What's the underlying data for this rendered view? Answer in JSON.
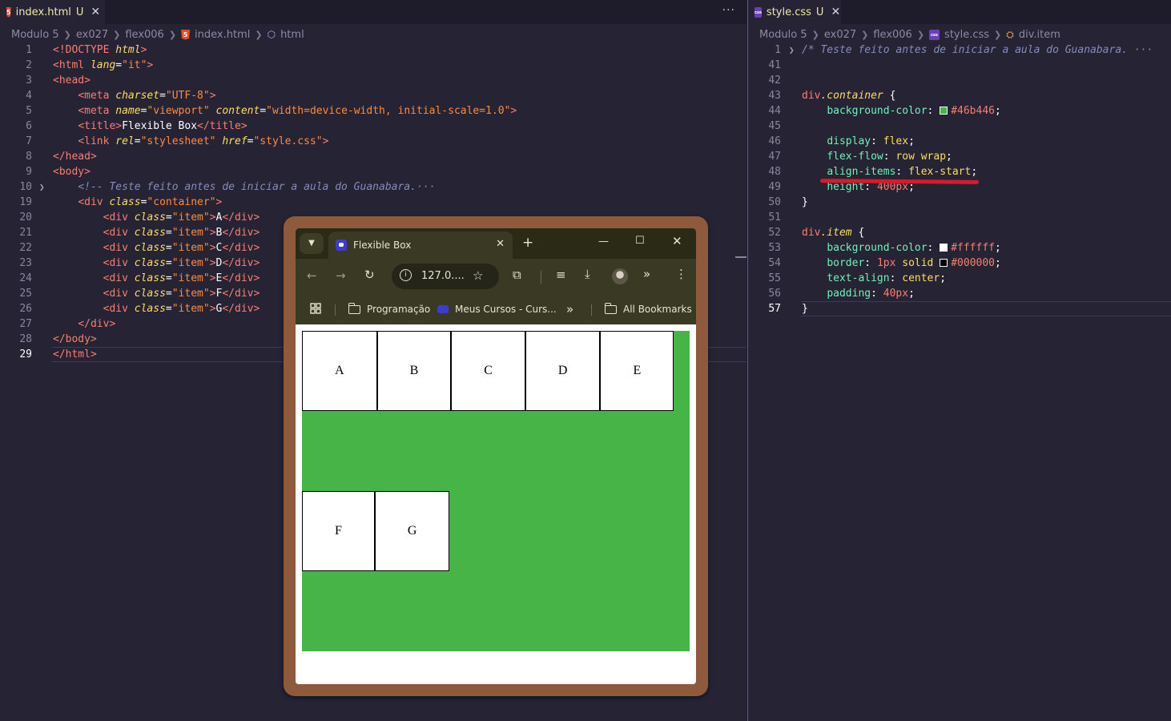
{
  "left_editor": {
    "tab": {
      "filename": "index.html",
      "status": "U",
      "icon": "html5-icon"
    },
    "more_actions": "···",
    "breadcrumb": [
      "Modulo 5",
      "ex027",
      "flex006",
      "index.html",
      "html"
    ],
    "lines": [
      {
        "n": "1",
        "parts": [
          [
            "t-tag",
            "<!"
          ],
          [
            "t-tag",
            "DOCTYPE"
          ],
          [
            "t-txt",
            " "
          ],
          [
            "t-attr",
            "html"
          ],
          [
            "t-tag",
            ">"
          ]
        ]
      },
      {
        "n": "2",
        "parts": [
          [
            "t-tag",
            "<html"
          ],
          [
            "t-txt",
            " "
          ],
          [
            "t-attr",
            "lang"
          ],
          [
            "t-pun",
            "="
          ],
          [
            "t-str",
            "\"it\""
          ],
          [
            "t-tag",
            ">"
          ]
        ]
      },
      {
        "n": "3",
        "parts": [
          [
            "t-tag",
            "<head>"
          ]
        ]
      },
      {
        "n": "4",
        "parts": [
          [
            "t-txt",
            "    "
          ],
          [
            "t-tag",
            "<meta"
          ],
          [
            "t-txt",
            " "
          ],
          [
            "t-attr",
            "charset"
          ],
          [
            "t-pun",
            "="
          ],
          [
            "t-str",
            "\"UTF-8\""
          ],
          [
            "t-tag",
            ">"
          ]
        ]
      },
      {
        "n": "5",
        "parts": [
          [
            "t-txt",
            "    "
          ],
          [
            "t-tag",
            "<meta"
          ],
          [
            "t-txt",
            " "
          ],
          [
            "t-attr",
            "name"
          ],
          [
            "t-pun",
            "="
          ],
          [
            "t-str",
            "\"viewport\""
          ],
          [
            "t-txt",
            " "
          ],
          [
            "t-attr",
            "content"
          ],
          [
            "t-pun",
            "="
          ],
          [
            "t-str",
            "\"width=device-width, initial-scale=1.0\""
          ],
          [
            "t-tag",
            ">"
          ]
        ]
      },
      {
        "n": "6",
        "parts": [
          [
            "t-txt",
            "    "
          ],
          [
            "t-tag",
            "<title>"
          ],
          [
            "t-txt",
            "Flexible Box"
          ],
          [
            "t-tag",
            "</title>"
          ]
        ]
      },
      {
        "n": "7",
        "parts": [
          [
            "t-txt",
            "    "
          ],
          [
            "t-tag",
            "<link"
          ],
          [
            "t-txt",
            " "
          ],
          [
            "t-attr",
            "rel"
          ],
          [
            "t-pun",
            "="
          ],
          [
            "t-str",
            "\"stylesheet\""
          ],
          [
            "t-txt",
            " "
          ],
          [
            "t-attr",
            "href"
          ],
          [
            "t-pun",
            "="
          ],
          [
            "t-str",
            "\"style.css\""
          ],
          [
            "t-tag",
            ">"
          ]
        ]
      },
      {
        "n": "8",
        "parts": [
          [
            "t-tag",
            "</head>"
          ]
        ]
      },
      {
        "n": "9",
        "parts": [
          [
            "t-tag",
            "<body>"
          ]
        ]
      },
      {
        "n": "10",
        "fold": true,
        "parts": [
          [
            "t-txt",
            "    "
          ],
          [
            "t-cmt",
            "<!-- Teste feito antes de iniciar a aula do Guanabara."
          ],
          [
            "t-ell",
            "···"
          ]
        ]
      },
      {
        "n": "19",
        "parts": [
          [
            "t-txt",
            "    "
          ],
          [
            "t-tag",
            "<div"
          ],
          [
            "t-txt",
            " "
          ],
          [
            "t-attr",
            "class"
          ],
          [
            "t-pun",
            "="
          ],
          [
            "t-str",
            "\"container\""
          ],
          [
            "t-tag",
            ">"
          ]
        ]
      },
      {
        "n": "20",
        "parts": [
          [
            "t-txt",
            "        "
          ],
          [
            "t-tag",
            "<div"
          ],
          [
            "t-txt",
            " "
          ],
          [
            "t-attr",
            "class"
          ],
          [
            "t-pun",
            "="
          ],
          [
            "t-str",
            "\"item\""
          ],
          [
            "t-tag",
            ">"
          ],
          [
            "t-txt",
            "A"
          ],
          [
            "t-tag",
            "</div>"
          ]
        ]
      },
      {
        "n": "21",
        "parts": [
          [
            "t-txt",
            "        "
          ],
          [
            "t-tag",
            "<div"
          ],
          [
            "t-txt",
            " "
          ],
          [
            "t-attr",
            "class"
          ],
          [
            "t-pun",
            "="
          ],
          [
            "t-str",
            "\"item\""
          ],
          [
            "t-tag",
            ">"
          ],
          [
            "t-txt",
            "B"
          ],
          [
            "t-tag",
            "</div>"
          ]
        ]
      },
      {
        "n": "22",
        "parts": [
          [
            "t-txt",
            "        "
          ],
          [
            "t-tag",
            "<div"
          ],
          [
            "t-txt",
            " "
          ],
          [
            "t-attr",
            "class"
          ],
          [
            "t-pun",
            "="
          ],
          [
            "t-str",
            "\"item\""
          ],
          [
            "t-tag",
            ">"
          ],
          [
            "t-txt",
            "C"
          ],
          [
            "t-tag",
            "</div>"
          ]
        ]
      },
      {
        "n": "23",
        "parts": [
          [
            "t-txt",
            "        "
          ],
          [
            "t-tag",
            "<div"
          ],
          [
            "t-txt",
            " "
          ],
          [
            "t-attr",
            "class"
          ],
          [
            "t-pun",
            "="
          ],
          [
            "t-str",
            "\"item\""
          ],
          [
            "t-tag",
            ">"
          ],
          [
            "t-txt",
            "D"
          ],
          [
            "t-tag",
            "</div>"
          ]
        ]
      },
      {
        "n": "24",
        "parts": [
          [
            "t-txt",
            "        "
          ],
          [
            "t-tag",
            "<div"
          ],
          [
            "t-txt",
            " "
          ],
          [
            "t-attr",
            "class"
          ],
          [
            "t-pun",
            "="
          ],
          [
            "t-str",
            "\"item\""
          ],
          [
            "t-tag",
            ">"
          ],
          [
            "t-txt",
            "E"
          ],
          [
            "t-tag",
            "</div>"
          ]
        ]
      },
      {
        "n": "25",
        "parts": [
          [
            "t-txt",
            "        "
          ],
          [
            "t-tag",
            "<div"
          ],
          [
            "t-txt",
            " "
          ],
          [
            "t-attr",
            "class"
          ],
          [
            "t-pun",
            "="
          ],
          [
            "t-str",
            "\"item\""
          ],
          [
            "t-tag",
            ">"
          ],
          [
            "t-txt",
            "F"
          ],
          [
            "t-tag",
            "</div>"
          ]
        ]
      },
      {
        "n": "26",
        "parts": [
          [
            "t-txt",
            "        "
          ],
          [
            "t-tag",
            "<div"
          ],
          [
            "t-txt",
            " "
          ],
          [
            "t-attr",
            "class"
          ],
          [
            "t-pun",
            "="
          ],
          [
            "t-str",
            "\"item\""
          ],
          [
            "t-tag",
            ">"
          ],
          [
            "t-txt",
            "G"
          ],
          [
            "t-tag",
            "</div>"
          ]
        ]
      },
      {
        "n": "27",
        "parts": [
          [
            "t-txt",
            "    "
          ],
          [
            "t-tag",
            "</div>"
          ]
        ]
      },
      {
        "n": "28",
        "parts": [
          [
            "t-tag",
            "</body>"
          ]
        ]
      },
      {
        "n": "29",
        "current": true,
        "parts": [
          [
            "t-tag",
            "</html>"
          ]
        ]
      }
    ]
  },
  "right_editor": {
    "tab": {
      "filename": "style.css",
      "status": "U",
      "icon": "css-icon"
    },
    "breadcrumb": [
      "Modulo 5",
      "ex027",
      "flex006",
      "style.css",
      "div.item"
    ],
    "lines": [
      {
        "n": "1",
        "fold": true,
        "parts": [
          [
            "t-cmt",
            "/* Teste feito antes de iniciar a aula do Guanabara."
          ],
          [
            "t-ell",
            " ···"
          ]
        ]
      },
      {
        "n": "41",
        "parts": []
      },
      {
        "n": "42",
        "parts": []
      },
      {
        "n": "43",
        "parts": [
          [
            "t-sel",
            "div"
          ],
          [
            "t-cls",
            ".container"
          ],
          [
            "t-pun",
            " {"
          ]
        ]
      },
      {
        "n": "44",
        "parts": [
          [
            "t-txt",
            "    "
          ],
          [
            "t-prop",
            "background-color"
          ],
          [
            "t-pun",
            ": "
          ],
          [
            "swatch",
            "#46b446"
          ],
          [
            "t-hex",
            "#46b446"
          ],
          [
            "t-pun",
            ";"
          ]
        ]
      },
      {
        "n": "45",
        "parts": []
      },
      {
        "n": "46",
        "parts": [
          [
            "t-txt",
            "    "
          ],
          [
            "t-prop",
            "display"
          ],
          [
            "t-pun",
            ": "
          ],
          [
            "t-val",
            "flex"
          ],
          [
            "t-pun",
            ";"
          ]
        ]
      },
      {
        "n": "47",
        "parts": [
          [
            "t-txt",
            "    "
          ],
          [
            "t-prop",
            "flex-flow"
          ],
          [
            "t-pun",
            ": "
          ],
          [
            "t-val",
            "row wrap"
          ],
          [
            "t-pun",
            ";"
          ]
        ]
      },
      {
        "n": "48",
        "parts": [
          [
            "t-txt",
            "    "
          ],
          [
            "t-prop",
            "align-items"
          ],
          [
            "t-pun",
            ": "
          ],
          [
            "t-val",
            "flex-start"
          ],
          [
            "t-pun",
            ";"
          ]
        ]
      },
      {
        "n": "49",
        "parts": [
          [
            "t-txt",
            "    "
          ],
          [
            "t-prop",
            "height"
          ],
          [
            "t-pun",
            ": "
          ],
          [
            "t-num",
            "400px"
          ],
          [
            "t-pun",
            ";"
          ]
        ]
      },
      {
        "n": "50",
        "parts": [
          [
            "t-pun",
            "}"
          ]
        ]
      },
      {
        "n": "51",
        "parts": []
      },
      {
        "n": "52",
        "parts": [
          [
            "t-sel",
            "div"
          ],
          [
            "t-cls",
            ".item"
          ],
          [
            "t-pun",
            " {"
          ]
        ]
      },
      {
        "n": "53",
        "parts": [
          [
            "t-txt",
            "    "
          ],
          [
            "t-prop",
            "background-color"
          ],
          [
            "t-pun",
            ": "
          ],
          [
            "swatch",
            "#ffffff"
          ],
          [
            "t-hex",
            "#ffffff"
          ],
          [
            "t-pun",
            ";"
          ]
        ]
      },
      {
        "n": "54",
        "parts": [
          [
            "t-txt",
            "    "
          ],
          [
            "t-prop",
            "border"
          ],
          [
            "t-pun",
            ": "
          ],
          [
            "t-num",
            "1px"
          ],
          [
            "t-val",
            " solid "
          ],
          [
            "swatch",
            "#000000"
          ],
          [
            "t-hex",
            "#000000"
          ],
          [
            "t-pun",
            ";"
          ]
        ]
      },
      {
        "n": "55",
        "parts": [
          [
            "t-txt",
            "    "
          ],
          [
            "t-prop",
            "text-align"
          ],
          [
            "t-pun",
            ": "
          ],
          [
            "t-val",
            "center"
          ],
          [
            "t-pun",
            ";"
          ]
        ]
      },
      {
        "n": "56",
        "parts": [
          [
            "t-txt",
            "    "
          ],
          [
            "t-prop",
            "padding"
          ],
          [
            "t-pun",
            ": "
          ],
          [
            "t-num",
            "40px"
          ],
          [
            "t-pun",
            ";"
          ]
        ]
      },
      {
        "n": "57",
        "current": true,
        "parts": [
          [
            "t-pun",
            "}"
          ]
        ]
      }
    ]
  },
  "browser": {
    "tab_title": "Flexible Box",
    "address": "127.0....",
    "bookmarks": {
      "item1": "Programação",
      "item2": "Meus Cursos - Curs...",
      "item3": "All Bookmarks"
    },
    "page": {
      "container_bg": "#46b446",
      "items": [
        "A",
        "B",
        "C",
        "D",
        "E",
        "F",
        "G"
      ]
    }
  },
  "colors": {
    "editor_bg": "#262335",
    "annotation_underline": "#d91a2a",
    "window_frame": "#8e5a3d"
  }
}
